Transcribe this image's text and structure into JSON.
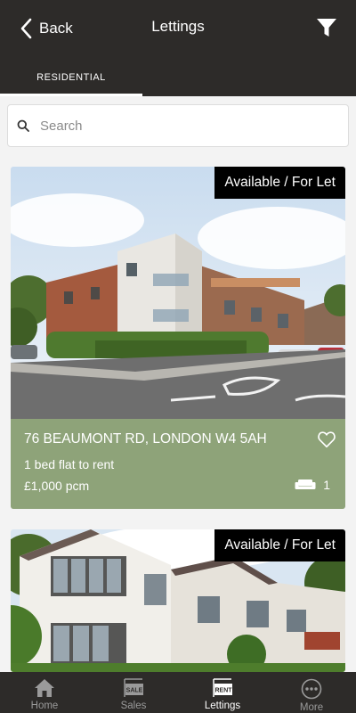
{
  "header": {
    "back_label": "Back",
    "title": "Lettings",
    "tab": "RESIDENTIAL"
  },
  "search": {
    "placeholder": "Search"
  },
  "listings": [
    {
      "badge": "Available / For Let",
      "address": "76 BEAUMONT RD, LONDON W4 5AH",
      "description": "1 bed flat to rent",
      "price": "£1,000 pcm",
      "bedrooms": "1"
    },
    {
      "badge": "Available / For Let"
    }
  ],
  "bottom_nav": [
    {
      "label": "Home",
      "icon": "home-icon"
    },
    {
      "label": "Sales",
      "icon": "sale-sign-icon",
      "sign_text": "SALE"
    },
    {
      "label": "Lettings",
      "icon": "rent-sign-icon",
      "sign_text": "RENT",
      "active": true
    },
    {
      "label": "More",
      "icon": "more-icon"
    }
  ],
  "colors": {
    "header_bg": "#2d2b29",
    "card_info_bg": "#8ea379",
    "badge_bg": "#000000"
  }
}
